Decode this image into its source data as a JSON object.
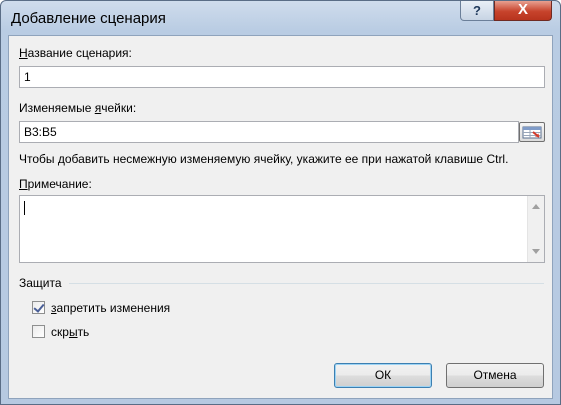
{
  "window": {
    "title": "Добавление сценария",
    "help_glyph": "?",
    "close_glyph": "X"
  },
  "scenario_name": {
    "label_mnemonic": "Н",
    "label_rest": "азвание сценария:",
    "value": "1"
  },
  "changing_cells": {
    "label_before": "Изменяемые ",
    "label_mnemonic": "я",
    "label_after": "чейки:",
    "value": "B3:B5",
    "range_button_icon": "range-select-icon"
  },
  "hint": "Чтобы добавить несмежную изменяемую ячейку, укажите ее при нажатой клавише Ctrl.",
  "comment": {
    "label_mnemonic": "П",
    "label_rest": "римечание:",
    "value": ""
  },
  "protection": {
    "group_label": "Защита",
    "prevent_changes": {
      "label_mnemonic": "з",
      "label_rest": "апретить изменения",
      "checked": true
    },
    "hide": {
      "label_before": "скр",
      "label_mnemonic": "ы",
      "label_after": "ть",
      "checked": false
    }
  },
  "buttons": {
    "ok": "ОК",
    "cancel": "Отмена"
  }
}
